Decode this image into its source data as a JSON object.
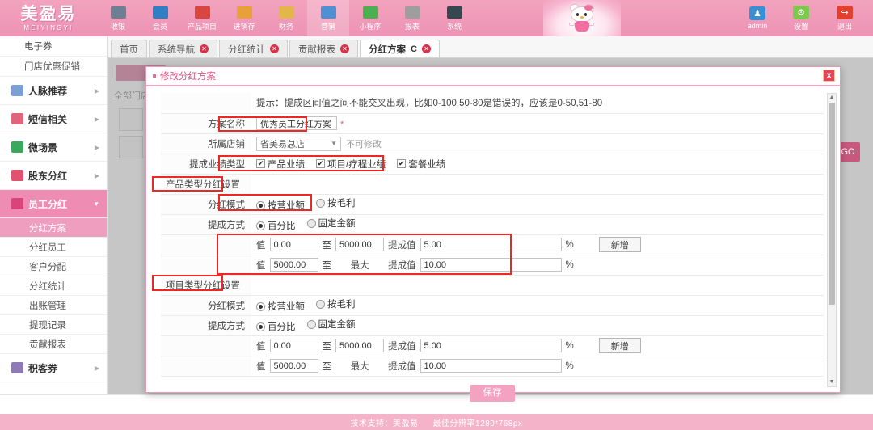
{
  "brand": {
    "cn": "美盈易",
    "en": "MEIYINGYI"
  },
  "topnav": {
    "items": [
      {
        "label": "收银",
        "icon": "cash-register-icon",
        "color": "#6d7f92",
        "active": false
      },
      {
        "label": "会员",
        "icon": "member-icon",
        "color": "#2f7fc7",
        "active": false
      },
      {
        "label": "产品项目",
        "icon": "product-icon",
        "color": "#d9453f",
        "active": false
      },
      {
        "label": "进销存",
        "icon": "inventory-icon",
        "color": "#e8a13a",
        "active": false
      },
      {
        "label": "财务",
        "icon": "finance-icon",
        "color": "#e3b64a",
        "active": false
      },
      {
        "label": "营销",
        "icon": "marketing-icon",
        "color": "#4f8fd6",
        "active": true
      },
      {
        "label": "小程序",
        "icon": "miniprogram-icon",
        "color": "#4caf50",
        "active": false
      },
      {
        "label": "报表",
        "icon": "report-icon",
        "color": "#9e9e9e",
        "active": false
      },
      {
        "label": "系统",
        "icon": "system-icon",
        "color": "#37474f",
        "active": false
      }
    ],
    "user_tools": [
      {
        "label": "admin",
        "icon": "user-avatar-icon",
        "color": "#3a8fd4",
        "glyph": "♟"
      },
      {
        "label": "设置",
        "icon": "gear-icon",
        "color": "#7ec850",
        "glyph": "⚙"
      },
      {
        "label": "退出",
        "icon": "logout-icon",
        "color": "#e0412f",
        "glyph": "↪"
      }
    ],
    "mascot": "hello-kitty-decoration"
  },
  "sidebar": {
    "items": [
      {
        "label": "电子券",
        "type": "plain",
        "active": false
      },
      {
        "label": "门店优惠促销",
        "type": "plain",
        "active": false
      },
      {
        "label": "人脉推荐",
        "type": "group",
        "icon": "globe-icon",
        "color": "#7b9fd4",
        "active": false
      },
      {
        "label": "短信相关",
        "type": "group",
        "icon": "phone-icon",
        "color": "#e0647a",
        "active": false
      },
      {
        "label": "微场景",
        "type": "group",
        "icon": "mobile-icon",
        "color": "#3ba85e",
        "active": false
      },
      {
        "label": "股东分红",
        "type": "group",
        "icon": "book-icon",
        "color": "#e0526e",
        "active": false
      },
      {
        "label": "员工分红",
        "type": "group",
        "icon": "staff-icon",
        "color": "#d8457a",
        "active": true
      },
      {
        "label": "分红方案",
        "type": "sub",
        "active": true
      },
      {
        "label": "分红员工",
        "type": "sub",
        "active": false
      },
      {
        "label": "客户分配",
        "type": "sub",
        "active": false
      },
      {
        "label": "分红统计",
        "type": "sub",
        "active": false
      },
      {
        "label": "出账管理",
        "type": "sub",
        "active": false
      },
      {
        "label": "提现记录",
        "type": "sub",
        "active": false
      },
      {
        "label": "贡献报表",
        "type": "sub",
        "active": false
      },
      {
        "label": "积客券",
        "type": "group",
        "icon": "ticket-icon",
        "color": "#8e7bb5",
        "active": false
      }
    ]
  },
  "tabs": [
    {
      "label": "首页",
      "closable": false,
      "active": false
    },
    {
      "label": "系统导航",
      "closable": true,
      "active": false
    },
    {
      "label": "分红统计",
      "closable": true,
      "active": false
    },
    {
      "label": "贡献报表",
      "closable": true,
      "active": false
    },
    {
      "label": "分红方案",
      "closable": true,
      "active": true,
      "refresh": "C"
    }
  ],
  "background": {
    "filter_label": "全部门店",
    "go_button": "GO"
  },
  "modal": {
    "title": "修改分红方案",
    "close": "x",
    "hint": "提示：提成区间值之间不能交叉出现，比如0-100,50-80是错误的，应该是0-50,51-80",
    "fields": {
      "plan_name_label": "方案名称",
      "plan_name_value": "优秀员工分红方案",
      "required_mark": "*",
      "store_label": "所属店铺",
      "store_value": "省美易总店",
      "store_note": "不可修改",
      "perf_type_label": "提成业绩类型",
      "perf_types": [
        {
          "label": "产品业绩",
          "checked": true
        },
        {
          "label": "项目/疗程业绩",
          "checked": true
        },
        {
          "label": "套餐业绩",
          "checked": true
        }
      ]
    },
    "sections": [
      {
        "section_title": "产品类型分红设置",
        "mode_label": "分红模式",
        "mode_options": [
          {
            "label": "按营业额",
            "selected": true
          },
          {
            "label": "按毛利",
            "selected": false
          }
        ],
        "method_label": "提成方式",
        "method_options": [
          {
            "label": "百分比",
            "selected": true
          },
          {
            "label": "固定金额",
            "selected": false
          }
        ],
        "rows": [
          {
            "from_label": "值",
            "from": "0.00",
            "to_label": "至",
            "to": "5000.00",
            "rate_label": "提成值",
            "rate": "5.00",
            "unit": "%",
            "add_button": "新增",
            "has_add": true,
            "to_is_text": false
          },
          {
            "from_label": "值",
            "from": "5000.00",
            "to_label": "至",
            "to": "最大",
            "rate_label": "提成值",
            "rate": "10.00",
            "unit": "%",
            "add_button": "",
            "has_add": false,
            "to_is_text": true
          }
        ]
      },
      {
        "section_title": "项目类型分红设置",
        "mode_label": "分红模式",
        "mode_options": [
          {
            "label": "按营业额",
            "selected": true
          },
          {
            "label": "按毛利",
            "selected": false
          }
        ],
        "method_label": "提成方式",
        "method_options": [
          {
            "label": "百分比",
            "selected": true
          },
          {
            "label": "固定金额",
            "selected": false
          }
        ],
        "rows": [
          {
            "from_label": "值",
            "from": "0.00",
            "to_label": "至",
            "to": "5000.00",
            "rate_label": "提成值",
            "rate": "5.00",
            "unit": "%",
            "add_button": "新增",
            "has_add": true,
            "to_is_text": false
          },
          {
            "from_label": "值",
            "from": "5000.00",
            "to_label": "至",
            "to": "最大",
            "rate_label": "提成值",
            "rate": "10.00",
            "unit": "%",
            "add_button": "",
            "has_add": false,
            "to_is_text": true
          }
        ]
      }
    ],
    "save_button": "保存"
  },
  "footer": {
    "support": "技术支持：美盈易",
    "resolution": "最佳分辨率1280*768px"
  },
  "colors": {
    "brand_pink": "#f2a3be",
    "accent_pink": "#ef8cb4",
    "annotation_red": "#ee2722",
    "danger_red": "#d9334a"
  }
}
